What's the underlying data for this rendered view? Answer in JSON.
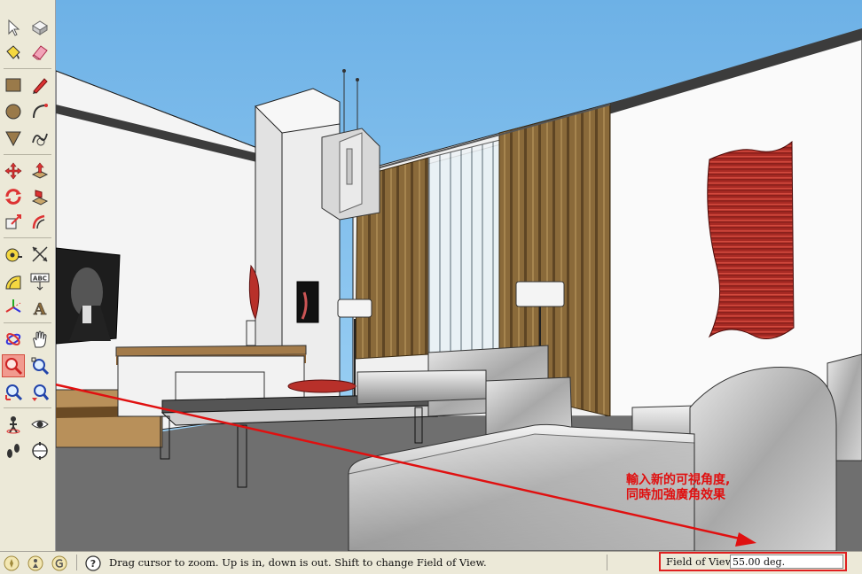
{
  "toolbar": {
    "tools": [
      {
        "name": "select-tool",
        "icon": "arrow-cursor-icon"
      },
      {
        "name": "make-component-tool",
        "icon": "component-icon"
      },
      {
        "name": "paint-bucket-tool",
        "icon": "paint-bucket-icon"
      },
      {
        "name": "eraser-tool",
        "icon": "eraser-icon"
      },
      {
        "name": "rectangle-tool",
        "icon": "rectangle-icon"
      },
      {
        "name": "line-tool",
        "icon": "pencil-icon"
      },
      {
        "name": "circle-tool",
        "icon": "circle-icon"
      },
      {
        "name": "arc-tool",
        "icon": "arc-icon"
      },
      {
        "name": "polygon-tool",
        "icon": "polygon-icon"
      },
      {
        "name": "freehand-tool",
        "icon": "freehand-icon"
      },
      {
        "name": "move-tool",
        "icon": "move-arrows-icon"
      },
      {
        "name": "push-pull-tool",
        "icon": "push-pull-icon"
      },
      {
        "name": "rotate-tool",
        "icon": "rotate-icon"
      },
      {
        "name": "follow-me-tool",
        "icon": "follow-me-icon"
      },
      {
        "name": "scale-tool",
        "icon": "scale-icon"
      },
      {
        "name": "offset-tool",
        "icon": "offset-icon"
      },
      {
        "name": "tape-measure-tool",
        "icon": "tape-measure-icon"
      },
      {
        "name": "dimension-tool",
        "icon": "dimension-icon"
      },
      {
        "name": "protractor-tool",
        "icon": "protractor-icon"
      },
      {
        "name": "text-tool",
        "icon": "text-label-icon"
      },
      {
        "name": "axes-tool",
        "icon": "axes-icon"
      },
      {
        "name": "3d-text-tool",
        "icon": "3d-text-icon"
      },
      {
        "name": "orbit-tool",
        "icon": "orbit-icon"
      },
      {
        "name": "pan-tool",
        "icon": "hand-icon"
      },
      {
        "name": "zoom-tool",
        "icon": "magnifier-icon"
      },
      {
        "name": "zoom-window-tool",
        "icon": "zoom-window-icon"
      },
      {
        "name": "zoom-extents-tool",
        "icon": "zoom-extents-icon"
      },
      {
        "name": "previous-view-tool",
        "icon": "previous-view-icon"
      },
      {
        "name": "position-camera-tool",
        "icon": "position-camera-icon"
      },
      {
        "name": "look-around-tool",
        "icon": "eye-icon"
      },
      {
        "name": "walk-tool",
        "icon": "footprints-icon"
      },
      {
        "name": "section-plane-tool",
        "icon": "section-plane-icon"
      }
    ],
    "active_tool": "zoom-tool",
    "text_tool_glyph": "ABC",
    "section_glyph": "A"
  },
  "status": {
    "hint": "Drag cursor to zoom.  Up is in, down is out. Shift to change Field of View.",
    "vcb_label": "Field of View",
    "vcb_value": "55.00 deg."
  },
  "annotation": {
    "line1": "輸入新的可視角度,",
    "line2": "同時加強廣角效果"
  },
  "colors": {
    "sky": "#8ec8f0",
    "floor": "#6f6f6f",
    "curtain": "#8a6a3a",
    "art": "#b8302a",
    "accent_red": "#e01010"
  }
}
